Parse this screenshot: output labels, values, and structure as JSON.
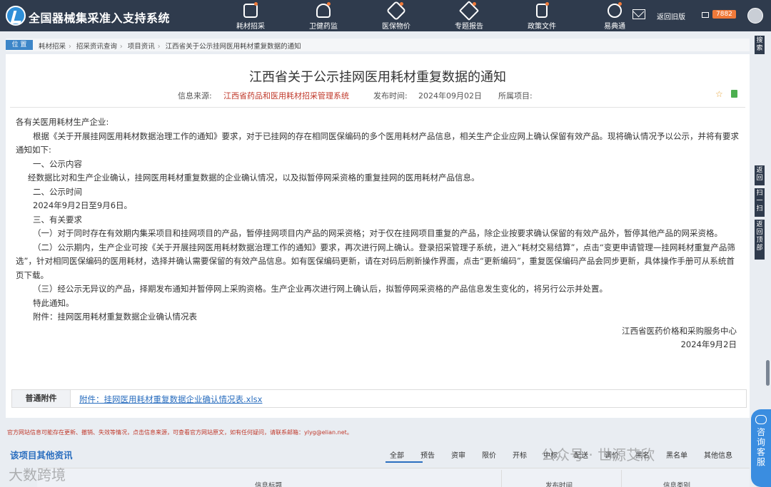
{
  "header": {
    "brand": "全国器械集采准入支持系统",
    "nav": [
      {
        "label": "耗材招采",
        "icon": "tag-icon"
      },
      {
        "label": "卫健药监",
        "icon": "cloud-icon"
      },
      {
        "label": "医保物价",
        "icon": "pill-icon"
      },
      {
        "label": "专题报告",
        "icon": "cube-icon"
      },
      {
        "label": "政策文件",
        "icon": "document-icon"
      },
      {
        "label": "易典通",
        "icon": "target-icon"
      }
    ],
    "old_version": "返回旧版",
    "msg_count": "7882"
  },
  "breadcrumb": {
    "badge": "位 置",
    "items": [
      "耗材招采",
      "招采资讯查询",
      "项目资讯",
      "江西省关于公示挂网医用耗材重复数据的通知"
    ]
  },
  "side": {
    "search": "搜索",
    "back": "返回",
    "scan": "扫一扫",
    "top": "返回顶部",
    "chat": "咨询客服"
  },
  "article": {
    "title": "江西省关于公示挂网医用耗材重复数据的通知",
    "source_label": "信息来源:",
    "source": "江西省药品和医用耗材招采管理系统",
    "date_label": "发布时间:",
    "date": "2024年09月02日",
    "project_label": "所属项目:",
    "paragraphs": [
      "各有关医用耗材生产企业:",
      "根据《关于开展挂网医用耗材数据治理工作的通知》要求，对于已挂网的存在相同医保编码的多个医用耗材产品信息，相关生产企业应网上确认保留有效产品。现将确认情况予以公示，并将有要求通知如下:",
      "一、公示内容",
      "经数据比对和生产企业确认，挂网医用耗材重复数据的企业确认情况，以及拟暂停网采资格的重复挂网的医用耗材产品信息。",
      "二、公示时间",
      "2024年9月2日至9月6日。",
      "三、有关要求",
      "（一）对于同时存在有效期内集采项目和挂网项目的产品，暂停挂网项目内产品的网采资格；对于仅在挂网项目重复的产品，除企业按要求确认保留的有效产品外，暂停其他产品的网采资格。",
      "（二）公示期内，生产企业可按《关于开展挂网医用耗材数据治理工作的通知》要求，再次进行网上确认。登录招采管理子系统，进入“耗材交易结算”，点击“变更申请管理—挂网耗材重复产品筛选”，针对相同医保编码的医用耗材，选择并确认需要保留的有效产品信息。如有医保编码更新，请在对码后刷新操作界面，点击“更新编码”，重复医保编码产品会同步更新，具体操作手册可从系统首页下载。",
      "（三）经公示无异议的产品，择期发布通知并暂停网上采购资格。生产企业再次进行网上确认后，拟暂停网采资格的产品信息发生变化的，将另行公示并处置。",
      "特此通知。",
      "附件：挂网医用耗材重复数据企业确认情况表"
    ],
    "signature": "江西省医药价格和采购服务中心",
    "sign_date": "2024年9月2日"
  },
  "attachment": {
    "label": "普通附件",
    "link": "附件：挂网医用耗材重复数据企业确认情况表.xlsx"
  },
  "notice": "官方网站信息可能存在更新、撤销、失效等情况，点击信息来源，可查看官方网站原文，如有任何疑问，请联系邮箱：ylyg@elian.net。",
  "more": {
    "title": "该项目其他资讯",
    "tabs": [
      "全部",
      "预告",
      "资审",
      "限价",
      "开标",
      "中标",
      "配送",
      "调价",
      "黑名",
      "黑名单",
      "其他信息"
    ],
    "columns": [
      "信息标题",
      "发布时间",
      "信息类别"
    ]
  },
  "watermarks": {
    "left": "大数跨境",
    "right": "公众号 · 世源艾欣"
  }
}
